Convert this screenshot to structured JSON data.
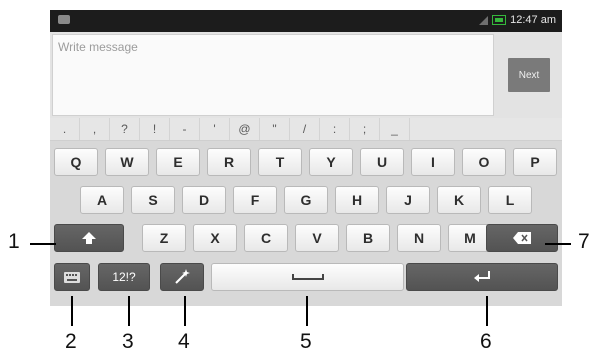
{
  "status_bar": {
    "time": "12:47 am"
  },
  "compose": {
    "placeholder": "Write message",
    "send_label": "Next"
  },
  "symbols": [
    ".",
    ",",
    "?",
    "!",
    "-",
    "'",
    "@",
    "\"",
    "/",
    ":",
    ";",
    "_"
  ],
  "rows": {
    "row1": [
      "Q",
      "W",
      "E",
      "R",
      "T",
      "Y",
      "U",
      "I",
      "O",
      "P"
    ],
    "row2": [
      "A",
      "S",
      "D",
      "F",
      "G",
      "H",
      "J",
      "K",
      "L"
    ],
    "row3": [
      "Z",
      "X",
      "C",
      "V",
      "B",
      "N",
      "M"
    ]
  },
  "function_keys": {
    "symbols_label": "12!?"
  },
  "callouts": [
    "1",
    "2",
    "3",
    "4",
    "5",
    "6",
    "7"
  ],
  "icons": {
    "shift": "shift-arrow-icon",
    "backspace": "backspace-icon",
    "keyboard": "keyboard-settings-icon",
    "wand": "magic-wand-icon",
    "space": "space-bar-icon",
    "enter": "enter-icon"
  }
}
